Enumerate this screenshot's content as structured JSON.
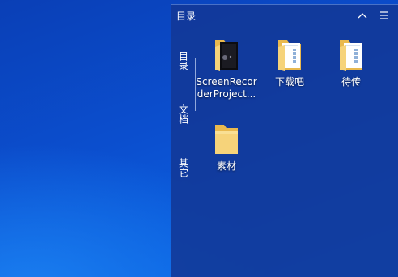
{
  "panel": {
    "title": "目录",
    "collapse_icon": "chevron-up-icon",
    "menu_icon": "hamburger-menu-icon"
  },
  "sidebar": {
    "tabs": [
      {
        "label": "目录",
        "active": true
      },
      {
        "label": "文档",
        "active": false
      },
      {
        "label": "其它",
        "active": false
      }
    ]
  },
  "items": [
    {
      "label": "ScreenRecorderProject...",
      "icon": "folder-icon-dark-content"
    },
    {
      "label": "下载吧",
      "icon": "folder-icon-documents"
    },
    {
      "label": "待传",
      "icon": "folder-icon-documents"
    },
    {
      "label": "素材",
      "icon": "folder-icon-empty"
    }
  ],
  "colors": {
    "folder": "#f6d37a",
    "folder_dark": "#e9b94e",
    "panel_bg": "#123896",
    "desktop": "#0b4fcf"
  }
}
